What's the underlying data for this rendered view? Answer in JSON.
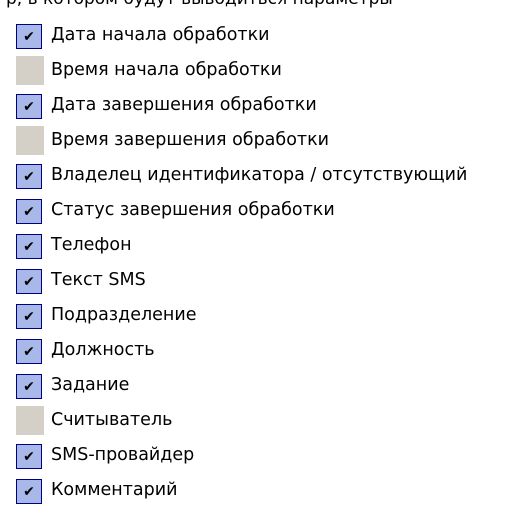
{
  "partial_top_text": "р, в котором будут выводиться параметры",
  "colors": {
    "checked_fill": "#a8b8e8",
    "checked_border": "#000080",
    "unchecked_gutter": "#d4d0c8"
  },
  "items": [
    {
      "label": "Дата начала обработки",
      "checked": true
    },
    {
      "label": "Время начала обработки",
      "checked": false
    },
    {
      "label": "Дата завершения обработки",
      "checked": true
    },
    {
      "label": "Время завершения обработки",
      "checked": false
    },
    {
      "label": "Владелец идентификатора / отсутствующий",
      "checked": true
    },
    {
      "label": "Статус завершения обработки",
      "checked": true
    },
    {
      "label": "Телефон",
      "checked": true
    },
    {
      "label": "Текст SMS",
      "checked": true
    },
    {
      "label": "Подразделение",
      "checked": true
    },
    {
      "label": "Должность",
      "checked": true
    },
    {
      "label": "Задание",
      "checked": true
    },
    {
      "label": "Считыватель",
      "checked": false
    },
    {
      "label": "SMS-провайдер",
      "checked": true
    },
    {
      "label": "Комментарий",
      "checked": true
    }
  ],
  "icons": {
    "checkmark": "✔"
  }
}
